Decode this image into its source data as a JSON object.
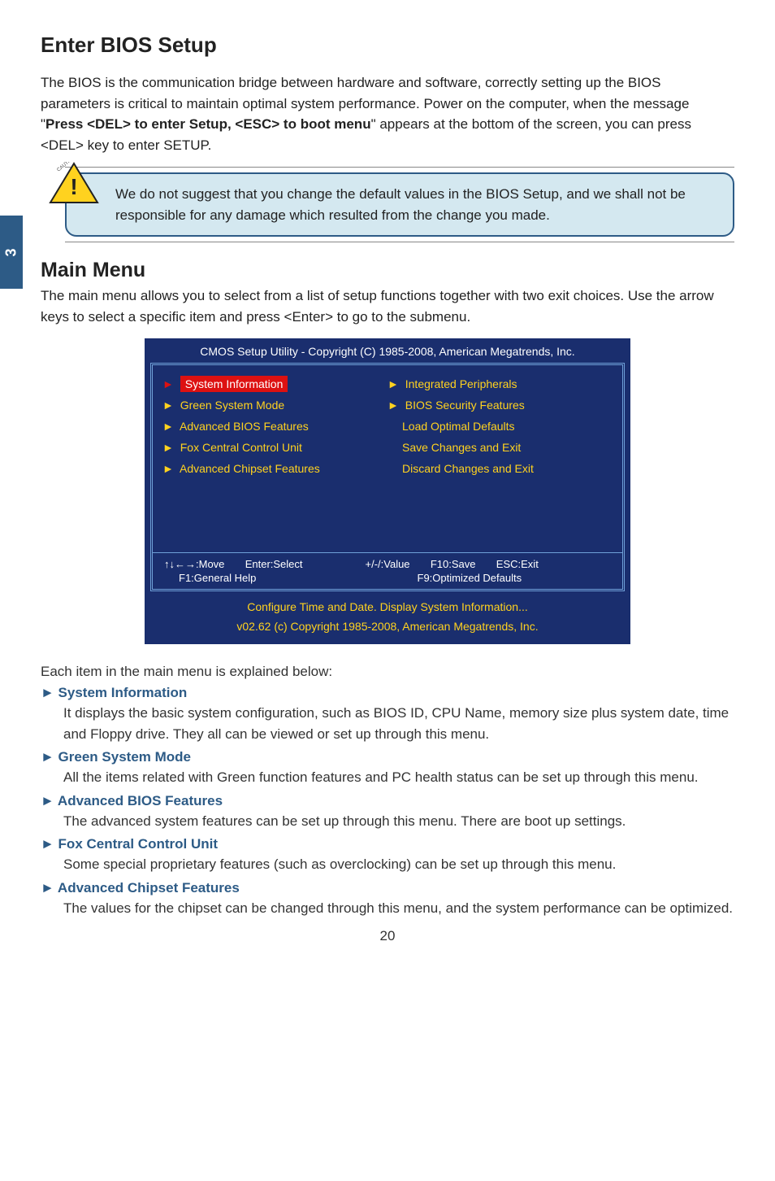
{
  "sideTab": "3",
  "h1": "Enter BIOS Setup",
  "intro_a": "The BIOS is the communication bridge between hardware and software, correctly setting up the BIOS parameters is critical to maintain optimal system performance. Power on the computer, when the message \"",
  "intro_bold": "Press <DEL> to enter Setup, <ESC> to boot menu",
  "intro_b": "\" appears at the bottom of the screen, you can press <DEL> key to enter SETUP.",
  "caution_rot": "CAUTION",
  "callout": "We do not suggest that you change the default values in the BIOS Setup, and we shall not be responsible for any damage which resulted from the change you made.",
  "h2": "Main Menu",
  "main_desc": "The main menu allows you to select from a list of setup functions together with two exit choices. Use the arrow keys to select a specific item and press <Enter> to go to the submenu.",
  "bios": {
    "title": "CMOS Setup Utility - Copyright (C) 1985-2008, American Megatrends, Inc.",
    "left": [
      {
        "label": "System Information",
        "selected": true
      },
      {
        "label": "Green System Mode"
      },
      {
        "label": "Advanced BIOS Features"
      },
      {
        "label": "Fox Central Control Unit"
      },
      {
        "label": "Advanced Chipset Features"
      }
    ],
    "right": [
      {
        "label": "Integrated Peripherals",
        "arrow": true
      },
      {
        "label": "BIOS Security Features",
        "arrow": true
      },
      {
        "label": "Load Optimal Defaults"
      },
      {
        "label": "Save Changes and Exit"
      },
      {
        "label": "Discard Changes and Exit"
      }
    ],
    "nav_l1a": "↑↓←→:Move",
    "nav_l1b": "Enter:Select",
    "nav_r1a": "+/-/:Value",
    "nav_r1b": "F10:Save",
    "nav_r1c": "ESC:Exit",
    "nav_l2": "F1:General Help",
    "nav_r2": "F9:Optimized Defaults",
    "footer1": "Configure Time and Date.   Display System Information...",
    "footer2": "v02.62   (c) Copyright 1985-2008, American Megatrends, Inc."
  },
  "explain_head": "Each item in the main menu is explained below:",
  "features": [
    {
      "title": "► System Information",
      "body": "It displays the basic system configuration, such as BIOS ID, CPU Name, memory size plus system date, time and Floppy drive. They all can be viewed or set up through this menu."
    },
    {
      "title": "► Green System Mode",
      "body": "All the items related with Green function features and PC health status can be set up through this menu."
    },
    {
      "title": "► Advanced BIOS Features",
      "body": "The advanced system features can be set up through this menu. There are boot up settings."
    },
    {
      "title": "► Fox Central Control Unit",
      "body": "Some special proprietary features (such as overclocking) can be set up through this menu."
    },
    {
      "title": "► Advanced Chipset Features",
      "body": "The values for the chipset can be changed through this menu, and the system performance can be optimized."
    }
  ],
  "pageNum": "20"
}
